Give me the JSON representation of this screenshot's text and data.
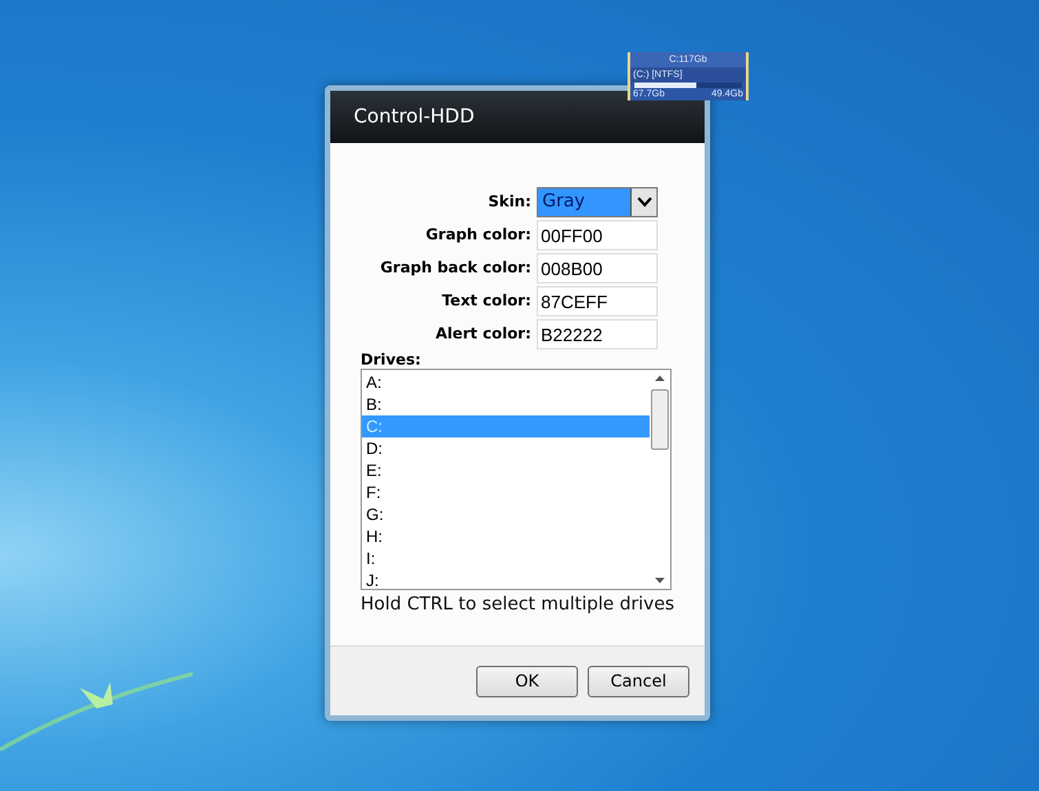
{
  "gadget": {
    "title": "C:117Gb",
    "drive": "(C:) [NTFS]",
    "level": 0.58,
    "used": "67.7Gb",
    "free": "49.4Gb"
  },
  "window": {
    "title": "Control-HDD"
  },
  "fields": [
    {
      "kind": "dropdown",
      "label": "Skin:",
      "value": "Gray"
    },
    {
      "kind": "text",
      "label": "Graph color:",
      "value": "00FF00"
    },
    {
      "kind": "text",
      "label": "Graph back color:",
      "value": "008B00"
    },
    {
      "kind": "text",
      "label": "Text color:",
      "value": "87CEFF"
    },
    {
      "kind": "text",
      "label": "Alert color:",
      "value": "B22222"
    }
  ],
  "drives": {
    "label": "Drives:",
    "items": [
      {
        "label": "A:",
        "selected": false
      },
      {
        "label": "B:",
        "selected": false
      },
      {
        "label": "C:",
        "selected": true
      },
      {
        "label": "D:",
        "selected": false
      },
      {
        "label": "E:",
        "selected": false
      },
      {
        "label": "F:",
        "selected": false
      },
      {
        "label": "G:",
        "selected": false
      },
      {
        "label": "H:",
        "selected": false
      },
      {
        "label": "I:",
        "selected": false
      },
      {
        "label": "J:",
        "selected": false
      }
    ],
    "hint": "Hold CTRL to select multiple drives"
  },
  "buttons": [
    "OK",
    "Cancel"
  ]
}
